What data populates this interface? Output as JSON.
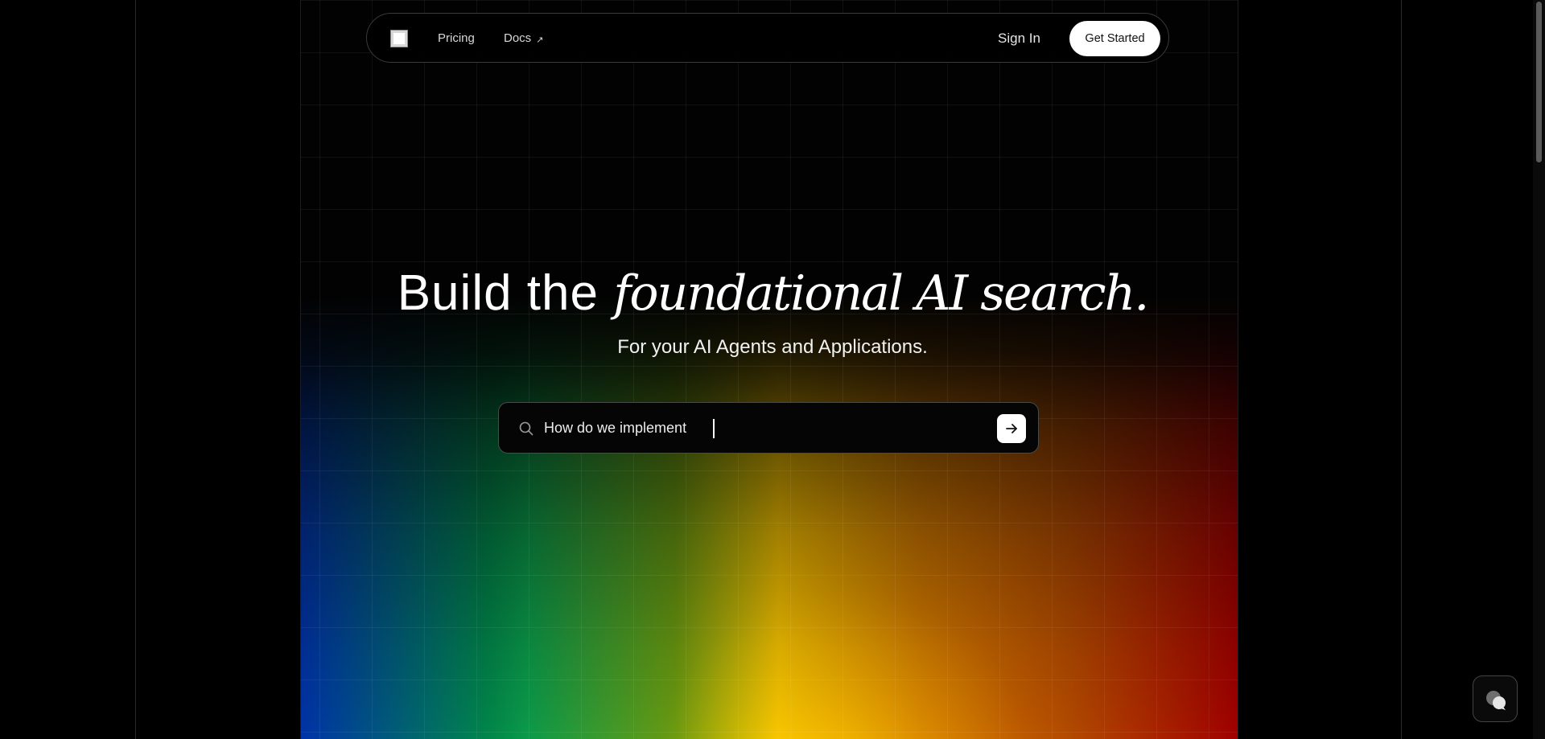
{
  "nav": {
    "pricing_label": "Pricing",
    "docs_label": "Docs",
    "docs_icon": "arrow-up-right-icon",
    "sign_in_label": "Sign In",
    "get_started_label": "Get Started",
    "logo_icon": "square-logo-icon"
  },
  "hero": {
    "headline_plain": "Build the ",
    "headline_fancy": "foundational AI search.",
    "subheadline": "For your AI Agents and Applications."
  },
  "search": {
    "icon": "search-icon",
    "value": "How do we implement",
    "submit_icon": "arrow-right-icon"
  },
  "chat_widget": {
    "icon": "chat-bubbles-icon"
  },
  "colors": {
    "background": "#000000",
    "text": "#ffffff",
    "button_bg": "#ffffff",
    "gradient": [
      "#0033a8",
      "#01864a",
      "#6b9a10",
      "#f7c200",
      "#d47a00",
      "#b34a00",
      "#a00000"
    ]
  }
}
